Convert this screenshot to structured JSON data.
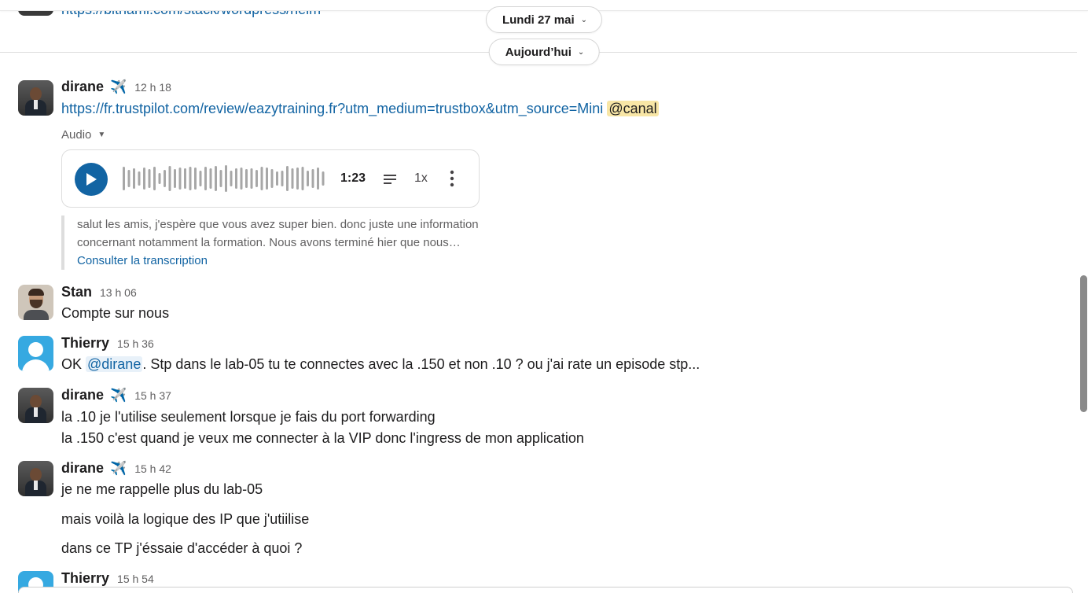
{
  "previous_message": {
    "link": "https://bitnami.com/stack/wordpress/helm"
  },
  "date_pills": [
    {
      "label": "Lundi 27 mai"
    },
    {
      "label": "Aujourd’hui"
    }
  ],
  "messages": [
    {
      "author": "dirane",
      "status_emoji": "✈️",
      "time": "12 h 18",
      "link": "https://fr.trustpilot.com/review/eazytraining.fr?utm_medium=trustbox&utm_source=Mini",
      "channel_mention": "@canal",
      "audio": {
        "label": "Audio",
        "duration": "1:23",
        "speed": "1x",
        "transcript_line1": "salut les amis, j'espère que vous avez super bien. donc juste une information",
        "transcript_line2": "concernant notamment la formation. Nous avons terminé hier que nous…",
        "transcript_link": "Consulter la transcription"
      }
    },
    {
      "author": "Stan",
      "time": "13 h 06",
      "text": "Compte sur nous"
    },
    {
      "author": "Thierry",
      "time": "15 h 36",
      "text_before": "OK ",
      "user_mention": "@dirane",
      "text_after": ". Stp dans le lab-05 tu te connectes avec la .150 et non .10 ? ou j'ai rate un episode stp..."
    },
    {
      "author": "dirane",
      "status_emoji": "✈️",
      "time": "15 h 37",
      "lines": [
        "la .10 je l'utilise seulement lorsque je fais du port forwarding",
        "la .150 c'est quand je veux me connecter à la VIP donc l'ingress de mon application"
      ]
    },
    {
      "author": "dirane",
      "status_emoji": "✈️",
      "time": "15 h 42",
      "lines": [
        "je ne me rappelle plus du lab-05",
        "mais voilà la logique des IP que j'utiilise",
        "dans ce TP j'éssaie d'accéder à quoi ?"
      ]
    },
    {
      "author": "Thierry",
      "time": "15 h 54"
    }
  ],
  "colors": {
    "link": "#1264a3",
    "channel_mention_bg": "#f8e6a6",
    "user_mention_bg": "#e8f1f9",
    "play_button": "#1264a3"
  }
}
